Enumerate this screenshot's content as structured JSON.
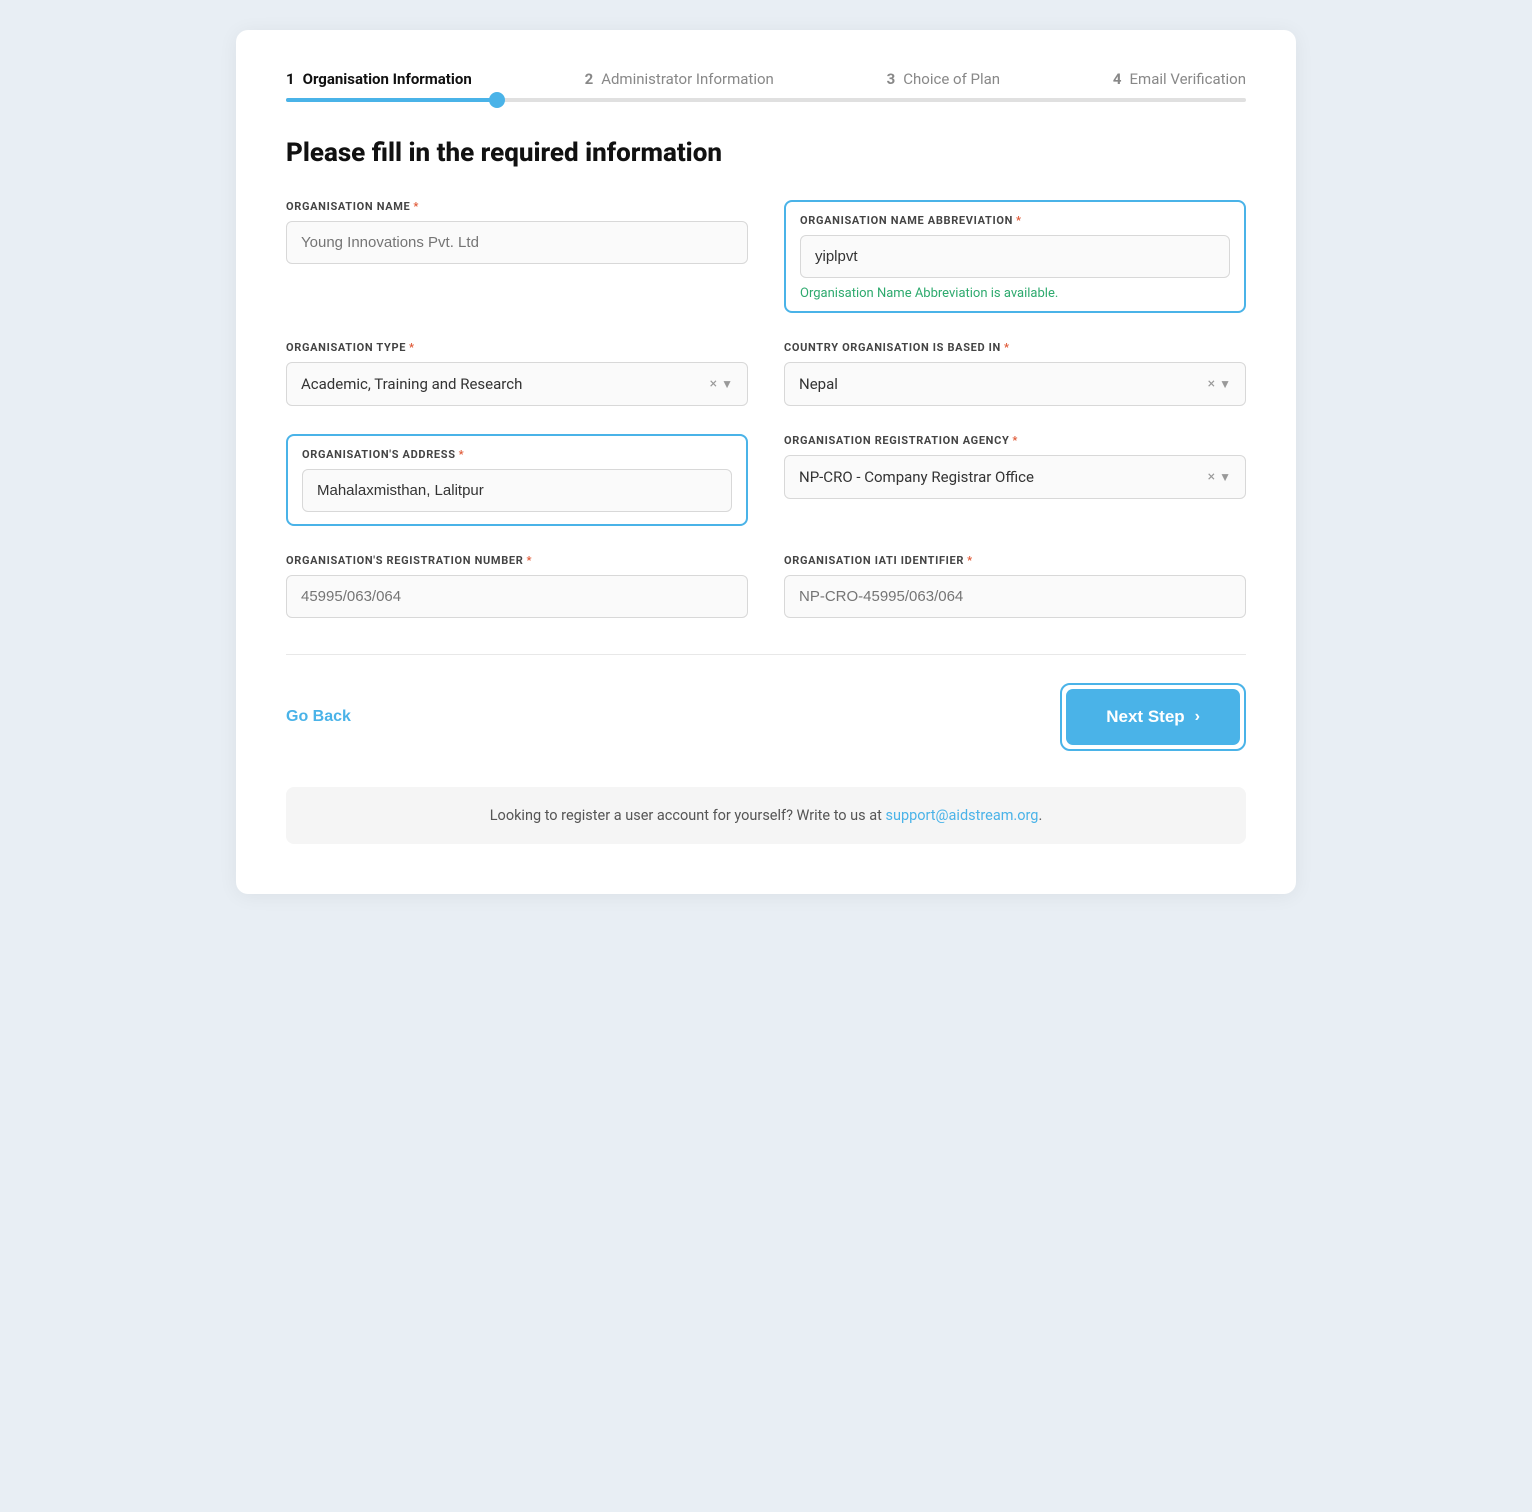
{
  "stepper": {
    "steps": [
      {
        "num": "1",
        "label": "Organisation Information",
        "active": true
      },
      {
        "num": "2",
        "label": "Administrator Information",
        "active": false
      },
      {
        "num": "3",
        "label": "Choice of Plan",
        "active": false
      },
      {
        "num": "4",
        "label": "Email Verification",
        "active": false
      }
    ]
  },
  "progress": {
    "width": "22%"
  },
  "form": {
    "heading": "Please fill in the required information",
    "fields": {
      "org_name_label": "ORGANISATION NAME",
      "org_name_placeholder": "Young Innovations Pvt. Ltd",
      "org_name_value": "",
      "org_abbrev_label": "ORGANISATION NAME ABBREVIATION",
      "org_abbrev_value": "yiplpvt",
      "org_abbrev_availability": "Organisation Name Abbreviation is available.",
      "org_type_label": "ORGANISATION TYPE",
      "org_type_value": "Academic, Training and Research",
      "country_label": "COUNTRY ORGANISATION IS BASED IN",
      "country_value": "Nepal",
      "address_label": "ORGANISATION'S ADDRESS",
      "address_value": "Mahalaxmisthan, Lalitpur",
      "reg_agency_label": "ORGANISATION REGISTRATION AGENCY",
      "reg_agency_value": "NP-CRO - Company Registrar Office",
      "reg_number_label": "ORGANISATION'S REGISTRATION NUMBER",
      "reg_number_placeholder": "45995/063/064",
      "reg_number_value": "",
      "iati_label": "ORGANISATION IATI IDENTIFIER",
      "iati_placeholder": "NP-CRO-45995/063/064",
      "iati_value": ""
    }
  },
  "actions": {
    "go_back": "Go Back",
    "next_step": "Next Step"
  },
  "info_bar": {
    "text_before": "Looking to register a user account for yourself? Write to us at ",
    "link_text": "support@aidstream.org",
    "text_after": "."
  }
}
